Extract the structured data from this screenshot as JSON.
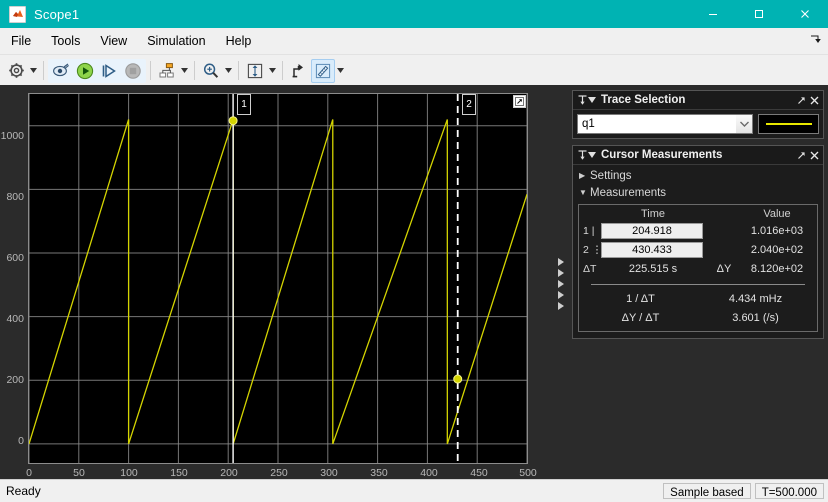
{
  "window": {
    "title": "Scope1",
    "app_icon": "matlab-membrane-icon",
    "minimize_label": "—",
    "maximize_label": "☐",
    "close_label": "✕",
    "titlebar_color": "#00b3b3"
  },
  "menu": {
    "items": [
      "File",
      "Tools",
      "View",
      "Simulation",
      "Help"
    ],
    "overflow_icon": "expand-arrow-icon"
  },
  "toolbar": {
    "buttons": [
      {
        "name": "configuration-properties",
        "icon": "gear-icon",
        "has_caret": true
      },
      {
        "name": "signal-selector",
        "icon": "scope-view-icon",
        "has_caret": false
      },
      {
        "name": "run",
        "icon": "play-icon",
        "has_caret": false
      },
      {
        "name": "step-forward",
        "icon": "step-forward-icon",
        "has_caret": false
      },
      {
        "name": "stop",
        "icon": "stop-icon",
        "has_caret": false
      },
      {
        "name": "simulink-model",
        "icon": "model-blocks-icon",
        "has_caret": true
      },
      {
        "name": "zoom",
        "icon": "magnifier-icon",
        "has_caret": true
      },
      {
        "name": "autoscale",
        "icon": "autoscale-icon",
        "has_caret": true
      },
      {
        "name": "style",
        "icon": "style-arrow-icon",
        "has_caret": false
      },
      {
        "name": "cursor-measurements",
        "icon": "pencil-measure-icon",
        "has_caret": true,
        "selected": true
      }
    ]
  },
  "plot": {
    "maximize_icon": "maximize-axes-icon",
    "splitter_icon": "splitter-arrows-icon",
    "cursor1_tag": "1",
    "cursor2_tag": "2"
  },
  "chart_data": {
    "type": "line",
    "title": "",
    "xlabel": "",
    "ylabel": "",
    "xlim": [
      0,
      500
    ],
    "ylim": [
      -60,
      1100
    ],
    "xticks": [
      0,
      50,
      100,
      150,
      200,
      250,
      300,
      350,
      400,
      450,
      500
    ],
    "yticks": [
      0,
      200,
      400,
      600,
      800,
      1000
    ],
    "grid": true,
    "background": "#000000",
    "series": [
      {
        "name": "q1",
        "color": "#d4d400",
        "waveform": "sawtooth",
        "amplitude_min": 0,
        "amplitude_max": 1016,
        "period": 105,
        "reset_times": [
          100,
          205,
          305,
          420
        ],
        "points": [
          [
            0,
            0
          ],
          [
            100,
            1020
          ],
          [
            100,
            0
          ],
          [
            205,
            1020
          ],
          [
            205,
            0
          ],
          [
            305,
            1020
          ],
          [
            305,
            0
          ],
          [
            420,
            1020
          ],
          [
            420,
            0
          ],
          [
            500,
            785
          ]
        ]
      }
    ],
    "cursors": [
      {
        "id": "1",
        "time": 204.918,
        "value": 1016,
        "style": "solid",
        "color": "#ffffff"
      },
      {
        "id": "2",
        "time": 430.433,
        "value": 204.0,
        "style": "dashed",
        "color": "#ffffff"
      }
    ]
  },
  "trace_selection": {
    "panel_title": "Trace Selection",
    "pin_icon": "pin-icon",
    "collapse_icon": "triangle-down-icon",
    "undock_icon": "undock-arrow-icon",
    "close_icon": "close-icon",
    "selected_trace": "q1",
    "dropdown_icon": "chevron-down-icon",
    "trace_color": "#e8e800"
  },
  "cursor_measurements": {
    "panel_title": "Cursor Measurements",
    "pin_icon": "pin-icon",
    "collapse_icon": "triangle-down-icon",
    "undock_icon": "undock-arrow-icon",
    "close_icon": "close-icon",
    "settings_label": "Settings",
    "settings_expanded": false,
    "measurements_label": "Measurements",
    "measurements_expanded": true,
    "headers": {
      "time": "Time",
      "value": "Value"
    },
    "rows": [
      {
        "id": "1 |",
        "time": "204.918",
        "value": "1.016e+03"
      },
      {
        "id": "2 ⋮",
        "time": "430.433",
        "value": "2.040e+02"
      }
    ],
    "delta": {
      "t_label": "ΔT",
      "t_value": "225.515 s",
      "y_label": "ΔY",
      "y_value": "8.120e+02"
    },
    "derived": [
      {
        "label": "1 / ΔT",
        "value": "4.434 mHz"
      },
      {
        "label": "ΔY / ΔT",
        "value": "3.601 (/s)"
      }
    ]
  },
  "statusbar": {
    "status": "Ready",
    "sample_mode": "Sample based",
    "time": "T=500.000"
  }
}
